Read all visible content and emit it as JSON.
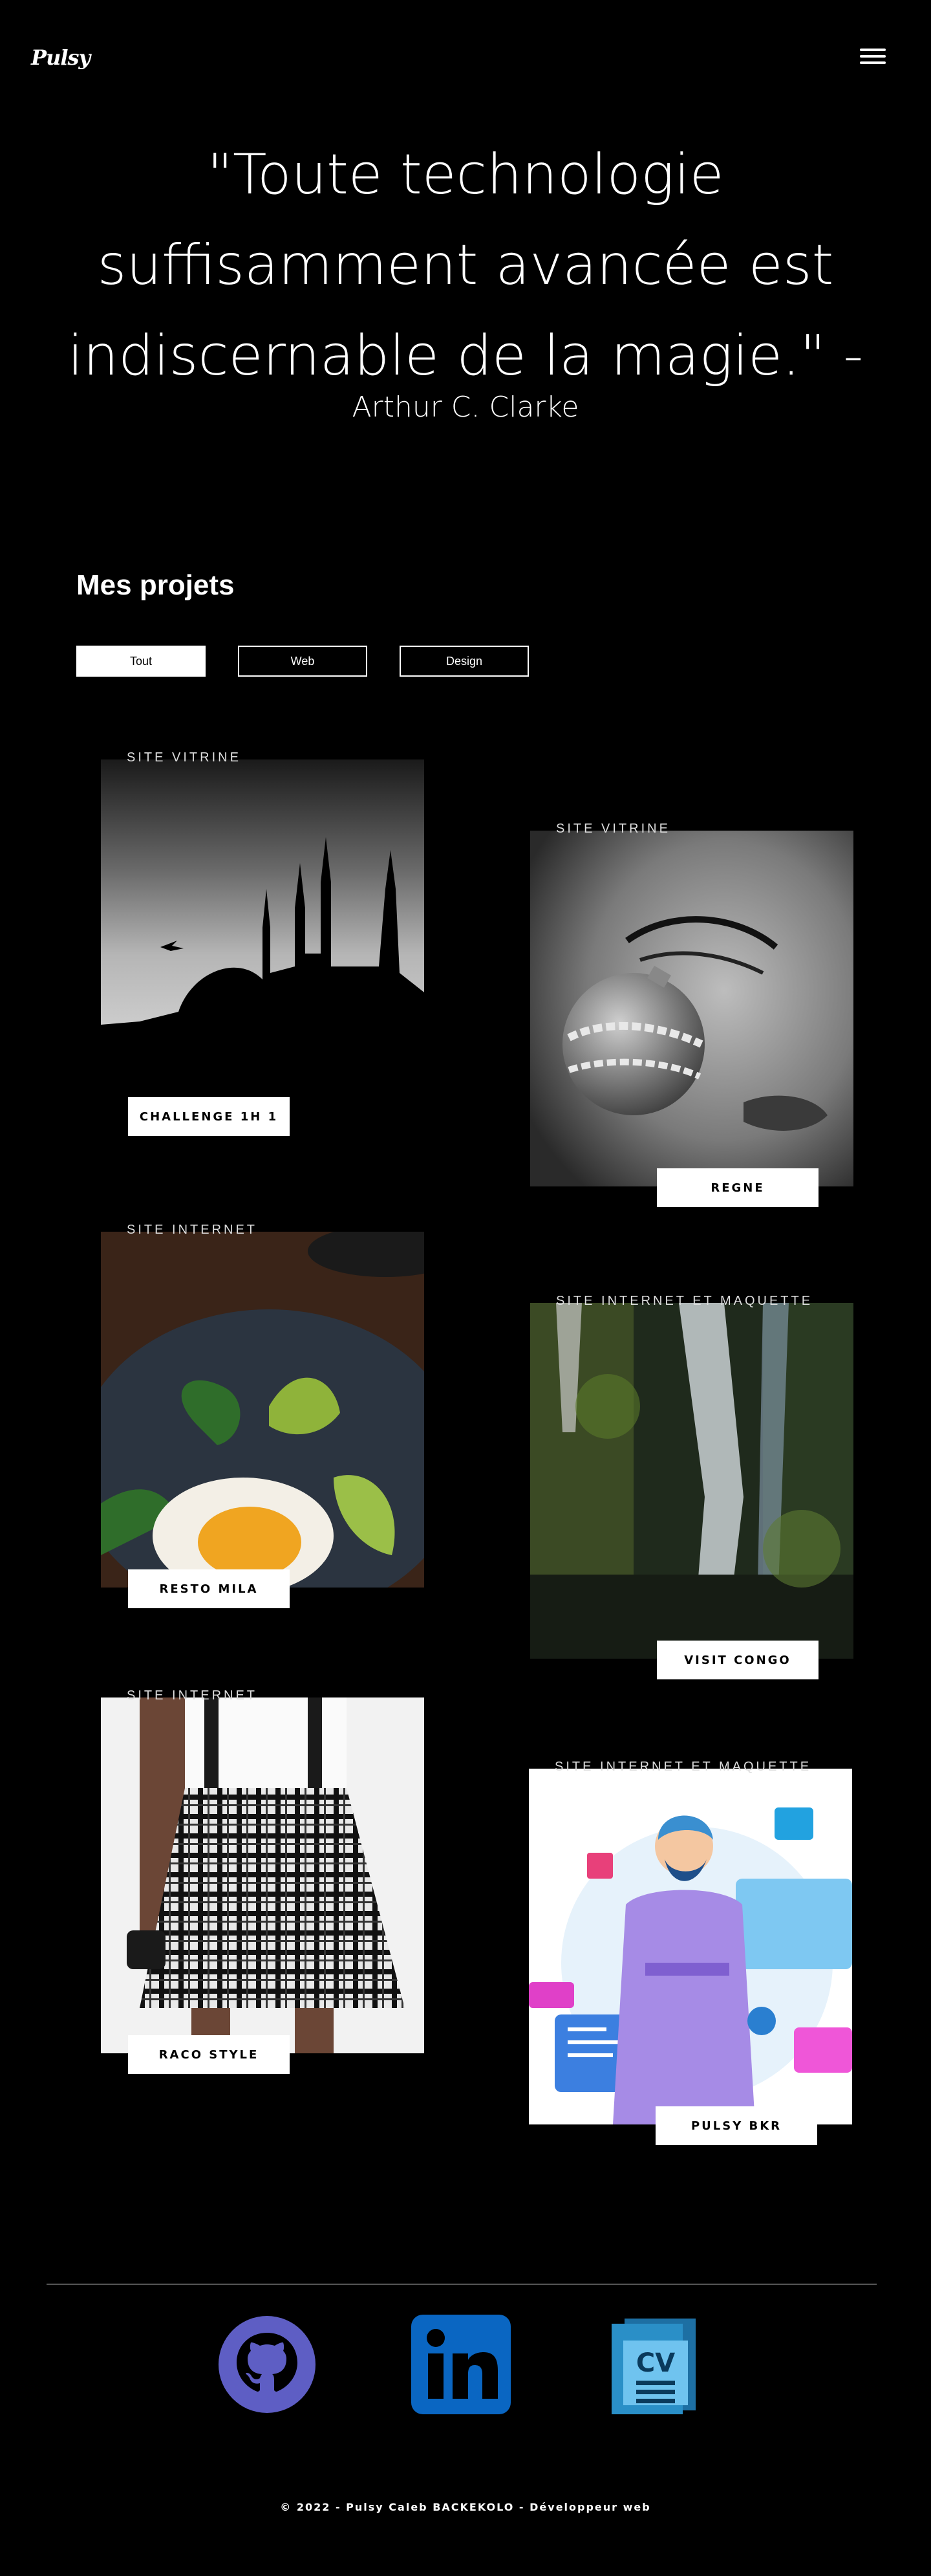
{
  "header": {
    "logo": "Pulsy"
  },
  "quote": {
    "text": "\"Toute technologie suffisamment avancée est indiscernable de la magie.\" -",
    "author": "Arthur C. Clarke"
  },
  "projects": {
    "title": "Mes projets",
    "filters": [
      "Tout",
      "Web",
      "Design"
    ],
    "items": [
      {
        "category": "SITE VITRINE",
        "label": "CHALLENGE 1H 1"
      },
      {
        "category": "SITE VITRINE",
        "label": "REGNE"
      },
      {
        "category": "SITE INTERNET",
        "label": "RESTO MILA"
      },
      {
        "category": "SITE INTERNET ET MAQUETTE",
        "label": "VISIT CONGO"
      },
      {
        "category": "SITE INTERNET",
        "label": "RACO STYLE"
      },
      {
        "category": "SITE INTERNET ET MAQUETTE",
        "label": "PULSY BKR"
      }
    ]
  },
  "social": {
    "icons": [
      "github-icon",
      "linkedin-icon",
      "cv-icon"
    ],
    "cv_text": "CV"
  },
  "footer": {
    "text": "© 2022 - Pulsy Caleb BACKEKOLO - Développeur web"
  },
  "colors": {
    "background": "#000000",
    "github": "#5e5ec4",
    "linkedin": "#0a66c2",
    "cv": "#2a8fc7"
  }
}
